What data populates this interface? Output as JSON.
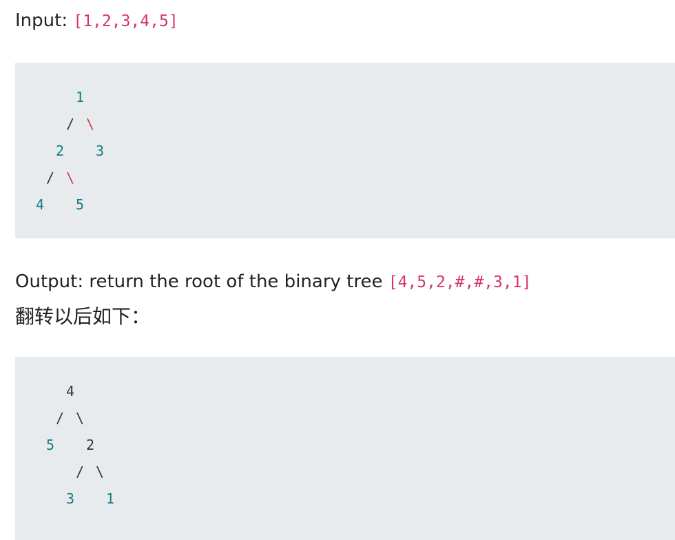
{
  "input_line": {
    "label": "Input: ",
    "code": "[1,2,3,4,5]"
  },
  "tree_before": {
    "root": "1",
    "left": "2",
    "right": "3",
    "left_left": "4",
    "left_right": "5",
    "slash": "/",
    "backslash": "\\"
  },
  "output_line": {
    "label": "Output: return the root of the binary tree ",
    "code": "[4,5,2,#,#,3,1]"
  },
  "caption": "翻转以后如下：",
  "tree_after": {
    "root": "4",
    "left": "5",
    "right": "2",
    "right_left": "3",
    "right_right": "1",
    "slash": "/",
    "backslash": "\\"
  },
  "colors": {
    "code_background": "#e8ebee",
    "inline_code": "#d6336c",
    "number_teal": "#117c80",
    "backslash_red": "#d33a3a"
  }
}
